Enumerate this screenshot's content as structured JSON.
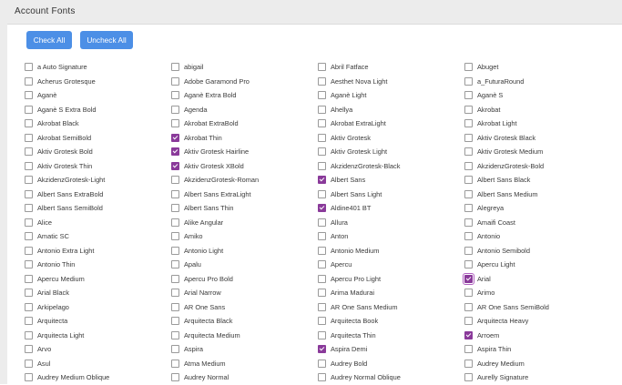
{
  "header": {
    "title": "Account Fonts"
  },
  "buttons": {
    "check_all": "Check All",
    "uncheck_all": "Uncheck All"
  },
  "colors": {
    "accent": "#4c8fe6",
    "checkbox_checked": "#8a3a9a",
    "header_bg": "#ececec"
  },
  "fonts": [
    {
      "name": "a Auto Signature",
      "checked": false
    },
    {
      "name": "abigail",
      "checked": false
    },
    {
      "name": "Abril Fatface",
      "checked": false
    },
    {
      "name": "Abuget",
      "checked": false
    },
    {
      "name": "Acherus Grotesque",
      "checked": false
    },
    {
      "name": "Adobe Garamond Pro",
      "checked": false
    },
    {
      "name": "Aesthet Nova Light",
      "checked": false
    },
    {
      "name": "a_FuturaRound",
      "checked": false
    },
    {
      "name": "Aganè",
      "checked": false
    },
    {
      "name": "Aganè Extra Bold",
      "checked": false
    },
    {
      "name": "Aganè Light",
      "checked": false
    },
    {
      "name": "Aganè S",
      "checked": false
    },
    {
      "name": "Aganè S Extra Bold",
      "checked": false
    },
    {
      "name": "Agenda",
      "checked": false
    },
    {
      "name": "Ahellya",
      "checked": false
    },
    {
      "name": "Akrobat",
      "checked": false
    },
    {
      "name": "Akrobat Black",
      "checked": false
    },
    {
      "name": "Akrobat ExtraBold",
      "checked": false
    },
    {
      "name": "Akrobat ExtraLight",
      "checked": false
    },
    {
      "name": "Akrobat Light",
      "checked": false
    },
    {
      "name": "Akrobat SemiBold",
      "checked": false
    },
    {
      "name": "Akrobat Thin",
      "checked": true
    },
    {
      "name": "Aktiv Grotesk",
      "checked": false
    },
    {
      "name": "Aktiv Grotesk Black",
      "checked": false
    },
    {
      "name": "Aktiv Grotesk Bold",
      "checked": false
    },
    {
      "name": "Aktiv Grotesk Hairline",
      "checked": true
    },
    {
      "name": "Aktiv Grotesk Light",
      "checked": false
    },
    {
      "name": "Aktiv Grotesk Medium",
      "checked": false
    },
    {
      "name": "Aktiv Grotesk Thin",
      "checked": false
    },
    {
      "name": "Aktiv Grotesk XBold",
      "checked": true
    },
    {
      "name": "AkzidenzGrotesk-Black",
      "checked": false
    },
    {
      "name": "AkzidenzGrotesk-Bold",
      "checked": false
    },
    {
      "name": "AkzidenzGrotesk-Light",
      "checked": false
    },
    {
      "name": "AkzidenzGrotesk-Roman",
      "checked": false
    },
    {
      "name": "Albert Sans",
      "checked": true
    },
    {
      "name": "Albert Sans Black",
      "checked": false
    },
    {
      "name": "Albert Sans ExtraBold",
      "checked": false
    },
    {
      "name": "Albert Sans ExtraLight",
      "checked": false
    },
    {
      "name": "Albert Sans Light",
      "checked": false
    },
    {
      "name": "Albert Sans Medium",
      "checked": false
    },
    {
      "name": "Albert Sans SemiBold",
      "checked": false
    },
    {
      "name": "Albert Sans Thin",
      "checked": false
    },
    {
      "name": "Aldine401 BT",
      "checked": true
    },
    {
      "name": "Alegreya",
      "checked": false
    },
    {
      "name": "Alice",
      "checked": false
    },
    {
      "name": "Alike Angular",
      "checked": false
    },
    {
      "name": "Allura",
      "checked": false
    },
    {
      "name": "Amaifi Coast",
      "checked": false
    },
    {
      "name": "Amatic SC",
      "checked": false
    },
    {
      "name": "Amiko",
      "checked": false
    },
    {
      "name": "Anton",
      "checked": false
    },
    {
      "name": "Antonio",
      "checked": false
    },
    {
      "name": "Antonio Extra Light",
      "checked": false
    },
    {
      "name": "Antonio Light",
      "checked": false
    },
    {
      "name": "Antonio Medium",
      "checked": false
    },
    {
      "name": "Antonio Semibold",
      "checked": false
    },
    {
      "name": "Antonio Thin",
      "checked": false
    },
    {
      "name": "Apalu",
      "checked": false
    },
    {
      "name": "Apercu",
      "checked": false
    },
    {
      "name": "Apercu Light",
      "checked": false
    },
    {
      "name": "Apercu Medium",
      "checked": false
    },
    {
      "name": "Apercu Pro Bold",
      "checked": false
    },
    {
      "name": "Apercu Pro Light",
      "checked": false
    },
    {
      "name": "Arial",
      "checked": true,
      "focused": true
    },
    {
      "name": "Arial Black",
      "checked": false
    },
    {
      "name": "Arial Narrow",
      "checked": false
    },
    {
      "name": "Arima Madurai",
      "checked": false
    },
    {
      "name": "Arimo",
      "checked": false
    },
    {
      "name": "Arkipelago",
      "checked": false
    },
    {
      "name": "AR One Sans",
      "checked": false
    },
    {
      "name": "AR One Sans Medium",
      "checked": false
    },
    {
      "name": "AR One Sans SemiBold",
      "checked": false
    },
    {
      "name": "Arquitecta",
      "checked": false
    },
    {
      "name": "Arquitecta Black",
      "checked": false
    },
    {
      "name": "Arquitecta Book",
      "checked": false
    },
    {
      "name": "Arquitecta Heavy",
      "checked": false
    },
    {
      "name": "Arquitecta Light",
      "checked": false
    },
    {
      "name": "Arquitecta Medium",
      "checked": false
    },
    {
      "name": "Arquitecta Thin",
      "checked": false
    },
    {
      "name": "Arroem",
      "checked": true
    },
    {
      "name": "Arvo",
      "checked": false
    },
    {
      "name": "Aspira",
      "checked": false
    },
    {
      "name": "Aspira Demi",
      "checked": true
    },
    {
      "name": "Aspira Thin",
      "checked": false
    },
    {
      "name": "Asul",
      "checked": false
    },
    {
      "name": "Atma Medium",
      "checked": false
    },
    {
      "name": "Audrey Bold",
      "checked": false
    },
    {
      "name": "Audrey Medium",
      "checked": false
    },
    {
      "name": "Audrey Medium Oblique",
      "checked": false
    },
    {
      "name": "Audrey Normal",
      "checked": false
    },
    {
      "name": "Audrey Normal Oblique",
      "checked": false
    },
    {
      "name": "Aurelly Signature",
      "checked": false
    }
  ]
}
